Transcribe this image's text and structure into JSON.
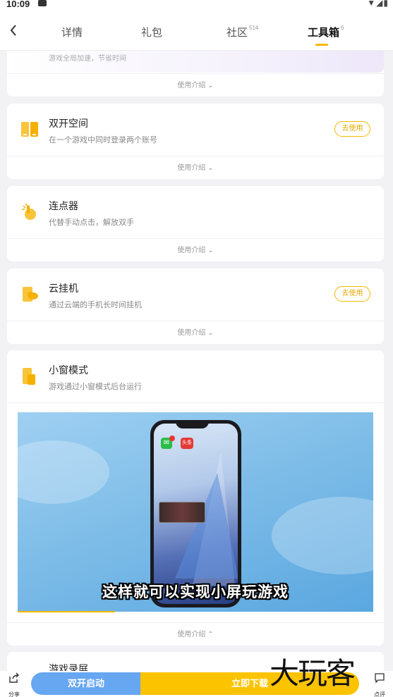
{
  "status": {
    "time": "10:09",
    "icons": "▼◢▮"
  },
  "header": {
    "back_icon": "chevron-left",
    "tabs": [
      {
        "label": "详情",
        "count": ""
      },
      {
        "label": "礼包",
        "count": ""
      },
      {
        "label": "社区",
        "count": "514"
      },
      {
        "label": "工具箱",
        "count": "6"
      }
    ],
    "active_tab": "工具箱"
  },
  "tools": [
    {
      "title": "",
      "desc": "游戏全局加速，节省时间",
      "intro": "使用介绍",
      "chevron": "⌄"
    },
    {
      "title": "双开空间",
      "desc": "在一个游戏中同时登录两个账号",
      "button": "去使用",
      "intro": "使用介绍",
      "chevron": "⌄",
      "icon": "dual-space-icon"
    },
    {
      "title": "连点器",
      "desc": "代替手动点击，解放双手",
      "intro": "使用介绍",
      "chevron": "⌄",
      "icon": "auto-clicker-icon"
    },
    {
      "title": "云挂机",
      "desc": "通过云端的手机长时间挂机",
      "button": "去使用",
      "intro": "使用介绍",
      "chevron": "⌄",
      "icon": "cloud-hangup-icon"
    },
    {
      "title": "小窗模式",
      "desc": "游戏通过小窗模式后台运行",
      "intro": "使用介绍",
      "chevron": "⌃",
      "icon": "small-window-icon",
      "video": {
        "subtitle": "这样就可以实现小屏玩游戏",
        "wechat_badge": "",
        "toutiao_label": "头条",
        "progress": 0.27
      }
    },
    {
      "title": "游戏录屏",
      "desc": ""
    }
  ],
  "bottom": {
    "share_label": "分享",
    "dual_open_label": "双开启动",
    "download_label": "立即下载",
    "review_label": "点评"
  },
  "watermark": "大玩客",
  "colors": {
    "accent": "#f5b800",
    "blue": "#67a6f1",
    "yellow": "#fbc300"
  }
}
